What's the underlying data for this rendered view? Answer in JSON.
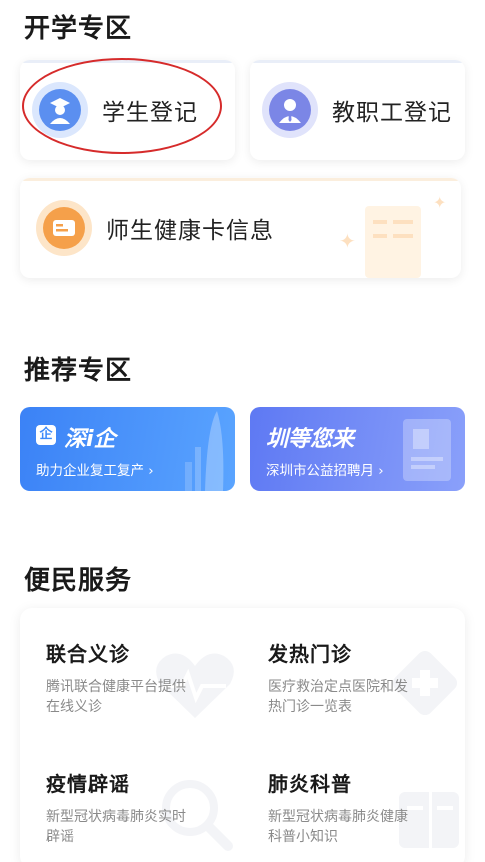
{
  "sections": {
    "school": "开学专区",
    "recommend": "推荐专区",
    "service": "便民服务"
  },
  "school": {
    "student_register": "学生登记",
    "staff_register": "教职工登记",
    "health_card": "师生健康卡信息"
  },
  "banners": [
    {
      "title": "深i企",
      "badge": "企",
      "subtitle": "助力企业复工复产 ›"
    },
    {
      "title": "圳等您来",
      "subtitle": "深圳市公益招聘月 ›"
    }
  ],
  "services": [
    {
      "title": "联合义诊",
      "desc": "腾讯联合健康平台提供在线义诊",
      "icon": "heart-pulse-icon"
    },
    {
      "title": "发热门诊",
      "desc": "医疗救治定点医院和发热门诊一览表",
      "icon": "hospital-cross-icon"
    },
    {
      "title": "疫情辟谣",
      "desc": "新型冠状病毒肺炎实时辟谣",
      "icon": "magnifier-icon"
    },
    {
      "title": "肺炎科普",
      "desc": "新型冠状病毒肺炎健康科普小知识",
      "icon": "book-icon"
    }
  ],
  "colors": {
    "student_icon": "#5b8ff0",
    "staff_icon": "#7b86e6",
    "health_icon": "#f5a04a",
    "banner1": "#3d8bfa",
    "banner2": "#6b82f5",
    "highlight": "#d62b2b"
  }
}
